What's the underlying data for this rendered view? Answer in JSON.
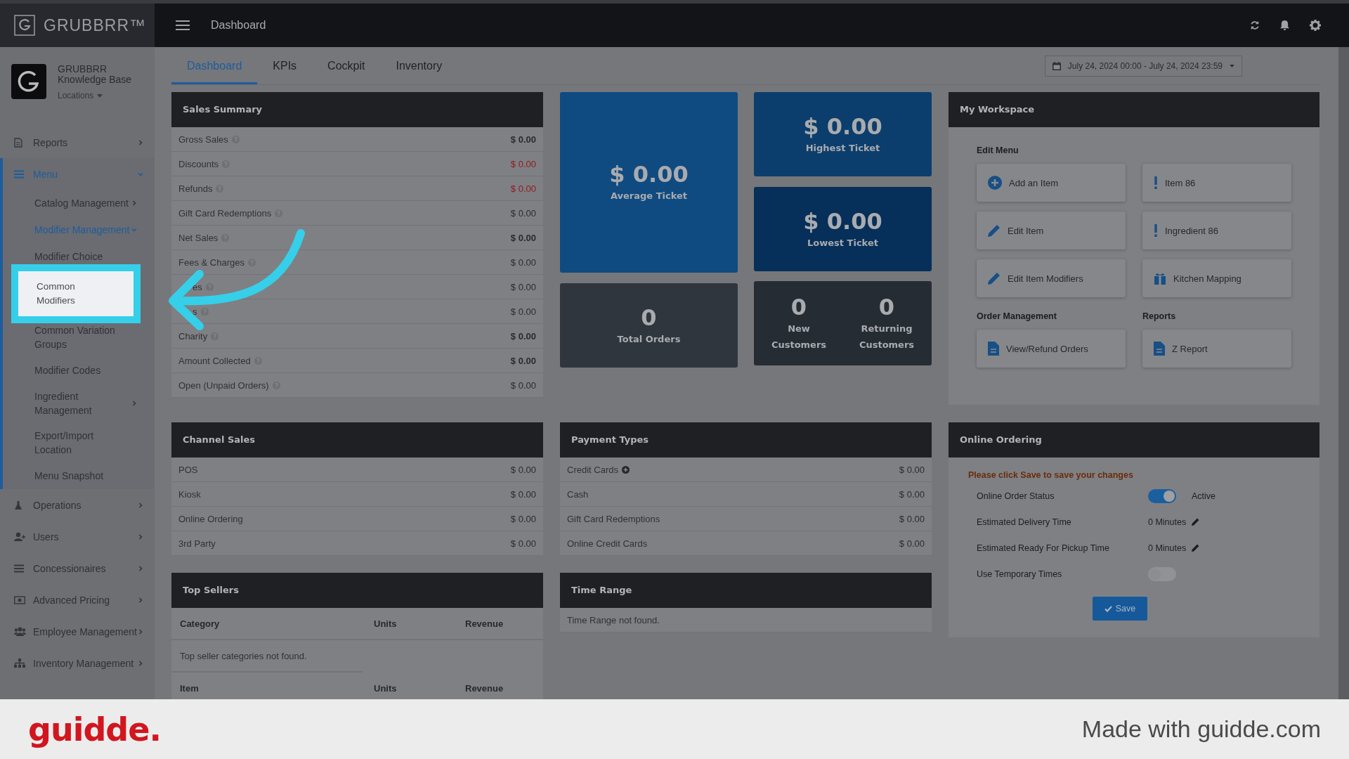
{
  "brand": {
    "name": "GRUBBRR™"
  },
  "topbar": {
    "title": "Dashboard"
  },
  "account": {
    "name": "GRUBBRR",
    "subtitle": "Knowledge Base",
    "locations": "Locations"
  },
  "sidebar": {
    "items": [
      {
        "label": "Reports",
        "selected": false,
        "expanded": false
      },
      {
        "label": "Menu",
        "selected": true,
        "expanded": true,
        "children": [
          {
            "label": "Catalog Management",
            "selected": false,
            "expanded": false
          },
          {
            "label": "Modifier Management",
            "selected": true,
            "expanded": true,
            "children": [
              {
                "label": "Modifier Choice",
                "highlighted": false
              },
              {
                "label": "Common Modifiers",
                "highlighted": true
              },
              {
                "label": "Common Variation Groups",
                "highlighted": false
              },
              {
                "label": "Modifier Codes",
                "highlighted": false
              }
            ]
          },
          {
            "label": "Ingredient Management",
            "selected": false,
            "expanded": false
          },
          {
            "label": "Export/Import Location",
            "selected": false
          },
          {
            "label": "Menu Snapshot",
            "selected": false
          }
        ]
      },
      {
        "label": "Operations",
        "selected": false,
        "expanded": false
      },
      {
        "label": "Users",
        "selected": false,
        "expanded": false
      },
      {
        "label": "Concessionaires",
        "selected": false,
        "expanded": false
      },
      {
        "label": "Advanced Pricing",
        "selected": false,
        "expanded": false
      },
      {
        "label": "Employee Management",
        "selected": false,
        "expanded": false
      },
      {
        "label": "Inventory Management",
        "selected": false,
        "expanded": false
      }
    ]
  },
  "tabs": [
    {
      "label": "Dashboard",
      "selected": true
    },
    {
      "label": "KPIs",
      "selected": false
    },
    {
      "label": "Cockpit",
      "selected": false
    },
    {
      "label": "Inventory",
      "selected": false
    }
  ],
  "date_range": "July 24, 2024 00:00 - July 24, 2024 23:59",
  "sales_summary": {
    "title": "Sales Summary",
    "rows": [
      {
        "label": "Gross Sales",
        "value": "$ 0.00",
        "emphasis": true,
        "negative": false
      },
      {
        "label": "Discounts",
        "value": "$ 0.00",
        "emphasis": false,
        "negative": true
      },
      {
        "label": "Refunds",
        "value": "$ 0.00",
        "emphasis": false,
        "negative": true
      },
      {
        "label": "Gift Card Redemptions",
        "value": "$ 0.00",
        "emphasis": false,
        "negative": false
      },
      {
        "label": "Net Sales",
        "value": "$ 0.00",
        "emphasis": true,
        "negative": false
      },
      {
        "label": "Fees & Charges",
        "value": "$ 0.00",
        "emphasis": false,
        "negative": false
      },
      {
        "label": "es",
        "value": "$ 0.00",
        "emphasis": false,
        "negative": false,
        "partly_covered": true
      },
      {
        "label": "s",
        "value": "$ 0.00",
        "emphasis": false,
        "negative": false,
        "partly_covered": true
      },
      {
        "label": "Charity",
        "value": "$ 0.00",
        "emphasis": true,
        "negative": false
      },
      {
        "label": "Amount Collected",
        "value": "$ 0.00",
        "emphasis": true,
        "negative": false
      },
      {
        "label": "Open (Unpaid Orders)",
        "value": "$ 0.00",
        "emphasis": false,
        "negative": false
      }
    ]
  },
  "stats": {
    "average_ticket": {
      "value": "$ 0.00",
      "label": "Average Ticket"
    },
    "highest_ticket": {
      "value": "$ 0.00",
      "label": "Highest Ticket"
    },
    "lowest_ticket": {
      "value": "$ 0.00",
      "label": "Lowest Ticket"
    },
    "total_orders": {
      "value": "0",
      "label": "Total Orders"
    },
    "customers": [
      {
        "value": "0",
        "label": "New Customers"
      },
      {
        "value": "0",
        "label": "Returning Customers"
      }
    ]
  },
  "workspace": {
    "title": "My Workspace",
    "sections": [
      {
        "title": "Edit Menu",
        "actions": [
          {
            "label": "Add an Item"
          },
          {
            "label": "Item 86"
          },
          {
            "label": "Edit Item"
          },
          {
            "label": "Ingredient 86"
          },
          {
            "label": "Edit Item Modifiers"
          },
          {
            "label": "Kitchen Mapping"
          }
        ]
      },
      {
        "title": "Order Management",
        "actions": [
          {
            "label": "View/Refund Orders"
          }
        ]
      },
      {
        "title": "Reports",
        "actions": [
          {
            "label": "Z Report"
          }
        ]
      }
    ]
  },
  "channel_sales": {
    "title": "Channel Sales",
    "rows": [
      {
        "label": "POS",
        "value": "$ 0.00"
      },
      {
        "label": "Kiosk",
        "value": "$ 0.00"
      },
      {
        "label": "Online Ordering",
        "value": "$ 0.00"
      },
      {
        "label": "3rd Party",
        "value": "$ 0.00"
      }
    ]
  },
  "payment_types": {
    "title": "Payment Types",
    "rows": [
      {
        "label": "Credit Cards",
        "value": "$ 0.00",
        "expandable": true
      },
      {
        "label": "Cash",
        "value": "$ 0.00",
        "expandable": false
      },
      {
        "label": "Gift Card Redemptions",
        "value": "$ 0.00",
        "expandable": false
      },
      {
        "label": "Online Credit Cards",
        "value": "$ 0.00",
        "expandable": false
      }
    ]
  },
  "top_sellers": {
    "title": "Top Sellers",
    "category_columns": [
      "Category",
      "Units",
      "Revenue"
    ],
    "empty_message": "Top seller categories not found.",
    "item_columns": [
      "Item",
      "Units",
      "Revenue"
    ]
  },
  "time_range": {
    "title": "Time Range",
    "message": "Time Range not found."
  },
  "online_ordering": {
    "title": "Online Ordering",
    "notice": "Please click Save to save your changes",
    "fields": [
      {
        "kind": "toggle",
        "label": "Online Order Status",
        "on": true,
        "status": "Active"
      },
      {
        "kind": "editable",
        "label": "Estimated Delivery Time",
        "value": "0 Minutes"
      },
      {
        "kind": "editable",
        "label": "Estimated Ready For Pickup Time",
        "value": "0 Minutes"
      },
      {
        "kind": "toggle",
        "label": "Use Temporary Times",
        "on": false
      }
    ],
    "save": "Save"
  },
  "footer_banner": {
    "logo": "guidde.",
    "text": "Made with guidde.com"
  }
}
